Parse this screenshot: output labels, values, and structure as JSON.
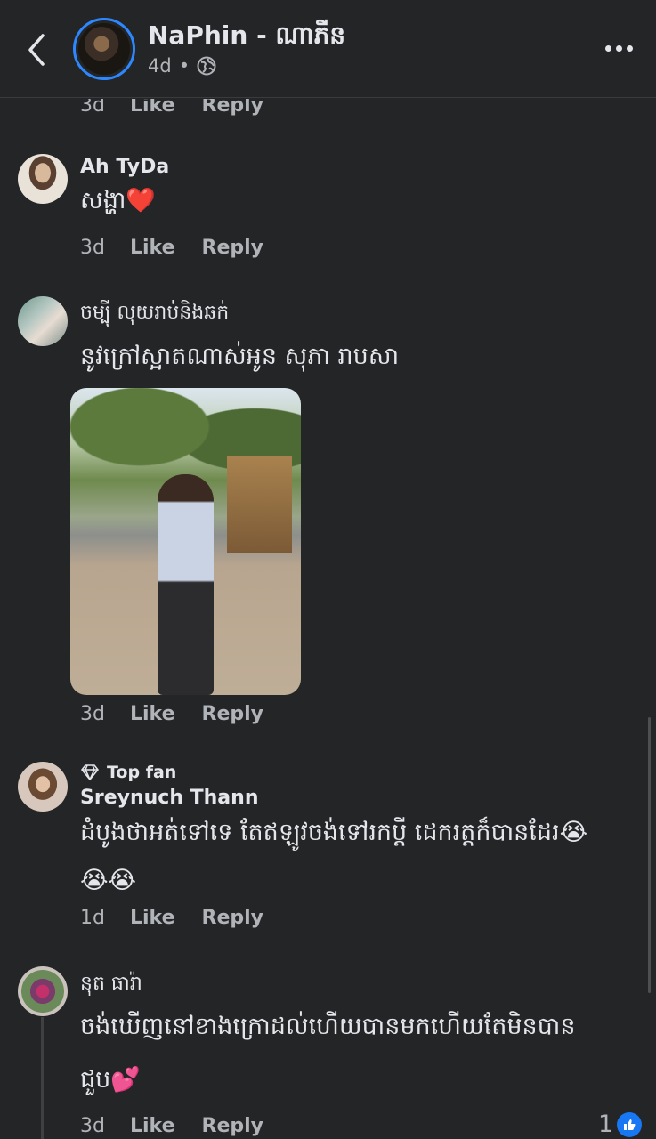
{
  "header": {
    "page_name": "NaPhin - ណាភីន",
    "time": "4d",
    "separator": "•",
    "icons": {
      "back": "chevron-left-icon",
      "privacy": "globe-icon",
      "more": "more-dots-icon"
    }
  },
  "actions": {
    "like": "Like",
    "reply": "Reply"
  },
  "comments": [
    {
      "time": "3d"
    },
    {
      "name": "Ah TyDa",
      "text": "សង្ហា❤️",
      "time": "3d"
    },
    {
      "name": "ចម្ប៉ី លុយរាប់និងឆក់",
      "text": "នូវក្រៅស្អាតណាស់អូន សុភា រាបសា",
      "time": "3d"
    },
    {
      "badge": "Top fan",
      "name": "Sreynuch Thann",
      "text_line1": "ដំបូងថាអត់ទៅទេ តែឥឡូវចង់ទៅរកប្ដី ដេករត្តក៏បានដែរ😭",
      "text_line2": "😭😭",
      "time": "1d"
    },
    {
      "name": "នុត ធារ៉ា",
      "text_line1": "ចង់ឃើញនៅខាងក្រោដល់ហើយបានមកហើយតែមិនបាន",
      "text_line2": "ជួប💕",
      "time": "3d",
      "reaction_count": "1"
    }
  ],
  "colors": {
    "background": "#242526",
    "text": "#e4e6eb",
    "secondary_text": "#b0b3b8",
    "accent": "#1877f2"
  }
}
